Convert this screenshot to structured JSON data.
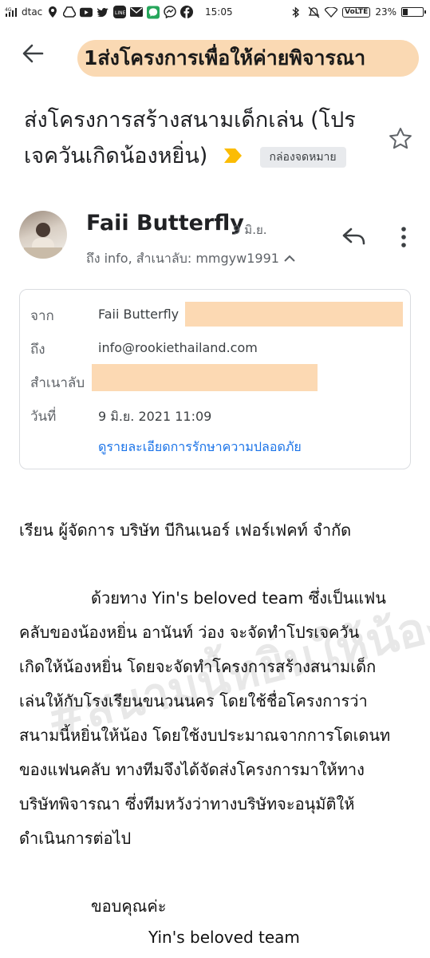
{
  "status_bar": {
    "network": "4G",
    "carrier": "dtac",
    "time": "15:05",
    "volte": "VoLTE",
    "battery_percent": "23%",
    "battery_level": 0.23
  },
  "banner": {
    "text": "1ส่งโครงการเพื่อให้ค่ายพิจารณา"
  },
  "email": {
    "subject_line1": "ส่งโครงการสร้างสนามเด็กเล่น (โปร",
    "subject_line2": "เจควันเกิดน้องหยิ่น)",
    "label": "กล่องจดหมาย"
  },
  "sender": {
    "name": "Faii Butterfly",
    "date": "9 มิ.ย.",
    "recipients": "ถึง info, สำเนาลับ: mmgyw1991"
  },
  "details": {
    "from_label": "จาก",
    "from_value": "Faii Butterfly",
    "to_label": "ถึง",
    "to_value": "info@rookiethailand.com",
    "bcc_label": "สำเนาลับ",
    "date_label": "วันที่",
    "date_value": "9 มิ.ย. 2021 11:09",
    "security_link": "ดูรายละเอียดการรักษาความปลอดภัย"
  },
  "body": {
    "greeting": "เรียน  ผู้จัดการ บริษัท บีกินเนอร์ เฟอร์เฟคท์ จำกัด",
    "lines": [
      "ด้วยทาง Yin's beloved team ซึ่งเป็นแฟน",
      "คลับของน้องหยิ่น อานันท์ ว่อง จะจัดทำโปรเจควัน",
      "เกิดให้น้องหยิ่น โดยจะจัดทำโครงการสร้างสนามเด็ก",
      "เล่นให้กับโรงเรียนขนวนนคร โดยใช้ชื่อโครงการว่า",
      "สนามนี้หยิ่นให้น้อง โดยใช้งบประมาณจากการโดเดนท",
      "ของแฟนคลับ ทางทีมจึงได้จัดส่งโครงการมาให้ทาง",
      "บริษัทพิจารณา ซึ่งทีมหวังว่าทางบริษัทจะอนุมัติให้",
      "ดำเนินการต่อไป"
    ],
    "closing": "ขอบคุณค่ะ",
    "signature": "Yin's beloved team"
  },
  "watermark": "#สนามนี้หยิ่นให้น้อง",
  "colors": {
    "banner": "#fad9b3",
    "link": "#1a73e8",
    "important_marker": "#fbbc04",
    "redaction": "#fcd9b3"
  }
}
